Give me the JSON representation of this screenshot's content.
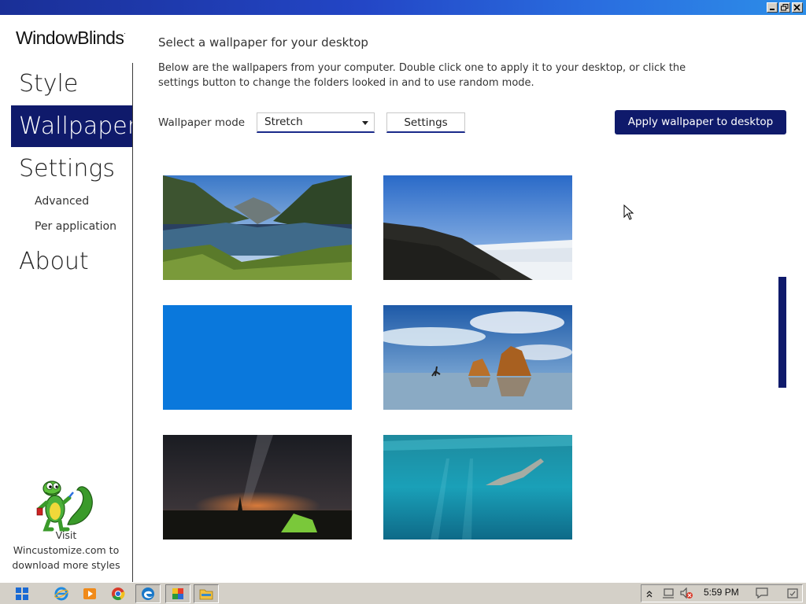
{
  "app": {
    "logo_text": "WindowBlinds",
    "logo_mark": "."
  },
  "sidebar": {
    "nav": [
      {
        "label": "Style"
      },
      {
        "label": "Wallpaper",
        "active": true
      },
      {
        "label": "Settings"
      }
    ],
    "sub_nav": [
      {
        "label": "Advanced"
      },
      {
        "label": "Per application"
      }
    ],
    "about_label": "About",
    "promo_lines": [
      "Visit",
      "Wincustomize.com to",
      "download more styles"
    ]
  },
  "main": {
    "title": "Select a wallpaper for your desktop",
    "description": "Below are the wallpapers from your computer.  Double click one to apply it to your desktop, or click the settings button to change the folders looked in and to use random mode.",
    "mode_label": "Wallpaper mode",
    "mode_value": "Stretch",
    "settings_label": "Settings",
    "apply_label": "Apply wallpaper to desktop",
    "wallpapers": [
      {
        "subject": "mountain-lake"
      },
      {
        "subject": "cloud-sea-hill"
      },
      {
        "subject": "solid-blue"
      },
      {
        "subject": "beach-rocks"
      },
      {
        "subject": "night-tent"
      },
      {
        "subject": "underwater-swimmer"
      }
    ]
  },
  "taskbar": {
    "clock": "5:59 PM",
    "apps": [
      "start-icon",
      "ie-icon",
      "media-player-icon",
      "chrome-icon",
      "edge-icon",
      "windowblinds-icon",
      "explorer-icon"
    ]
  },
  "colors": {
    "accent": "#0f1a6b",
    "title_bar_start": "#1a2f97",
    "title_bar_end": "#2d8ee8"
  }
}
